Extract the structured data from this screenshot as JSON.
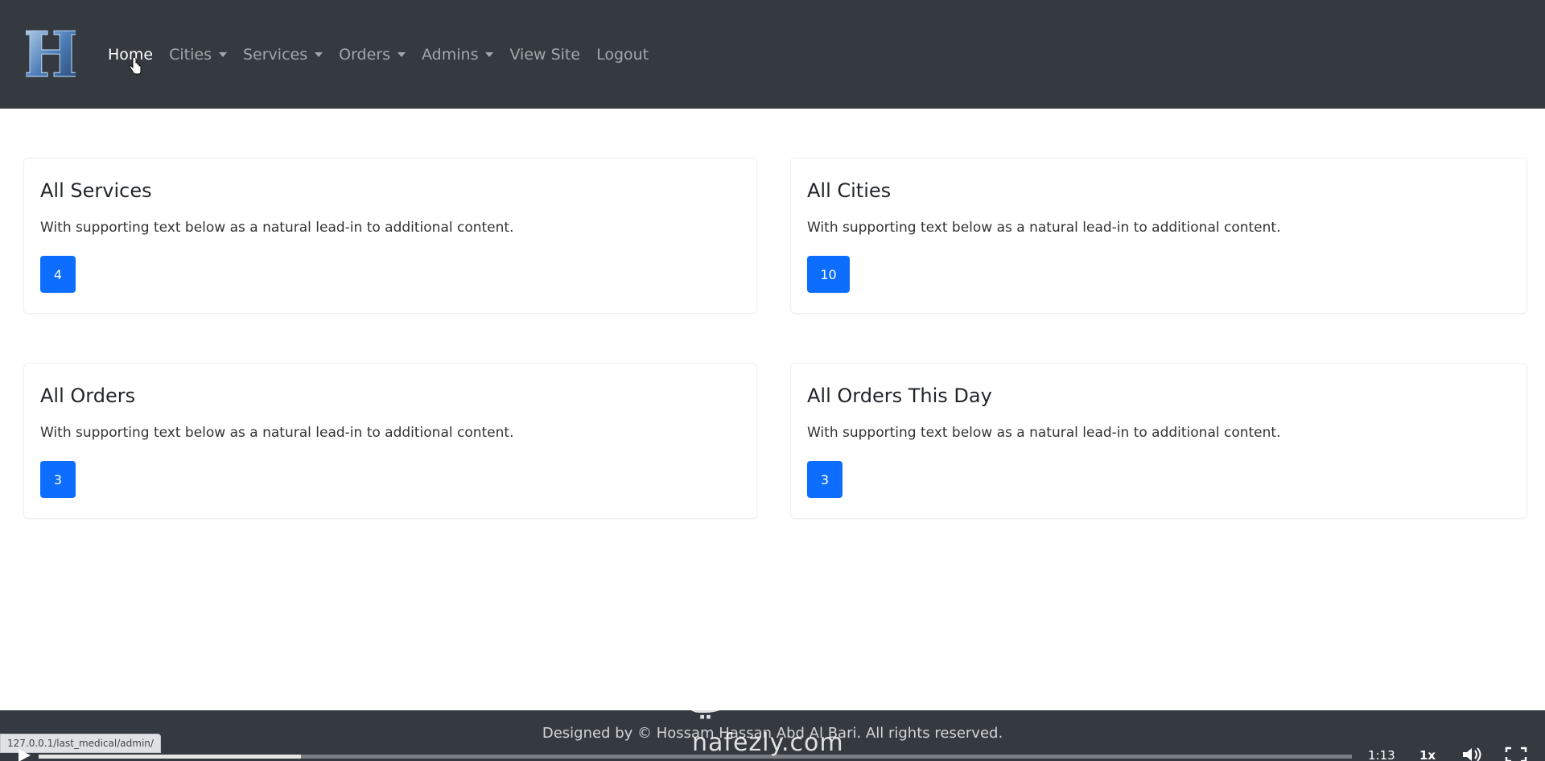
{
  "nav": {
    "brand_letter": "H",
    "items": [
      {
        "label": "Home",
        "dropdown": false,
        "active": true
      },
      {
        "label": "Cities",
        "dropdown": true,
        "active": false
      },
      {
        "label": "Services",
        "dropdown": true,
        "active": false
      },
      {
        "label": "Orders",
        "dropdown": true,
        "active": false
      },
      {
        "label": "Admins",
        "dropdown": true,
        "active": false
      },
      {
        "label": "View Site",
        "dropdown": false,
        "active": false
      },
      {
        "label": "Logout",
        "dropdown": false,
        "active": false
      }
    ]
  },
  "cards": [
    {
      "title": "All Services",
      "text": "With supporting text below as a natural lead-in to additional content.",
      "count": "4"
    },
    {
      "title": "All Cities",
      "text": "With supporting text below as a natural lead-in to additional content.",
      "count": "10"
    },
    {
      "title": "All Orders",
      "text": "With supporting text below as a natural lead-in to additional content.",
      "count": "3"
    },
    {
      "title": "All Orders This Day",
      "text": "With supporting text below as a natural lead-in to additional content.",
      "count": "3"
    }
  ],
  "footer": {
    "text": "Designed by © Hossam Hassan Abd Al Bari. All rights reserved."
  },
  "status_bar": {
    "url": "127.0.0.1/last_medical/admin/"
  },
  "watermark": {
    "arabic": "نفذلي",
    "latin": "nafezly.com"
  },
  "video_player": {
    "time": "1:13",
    "speed": "1x",
    "progress": 0.2
  },
  "colors": {
    "navbar": "#343a40",
    "primary": "#0d6efd"
  }
}
